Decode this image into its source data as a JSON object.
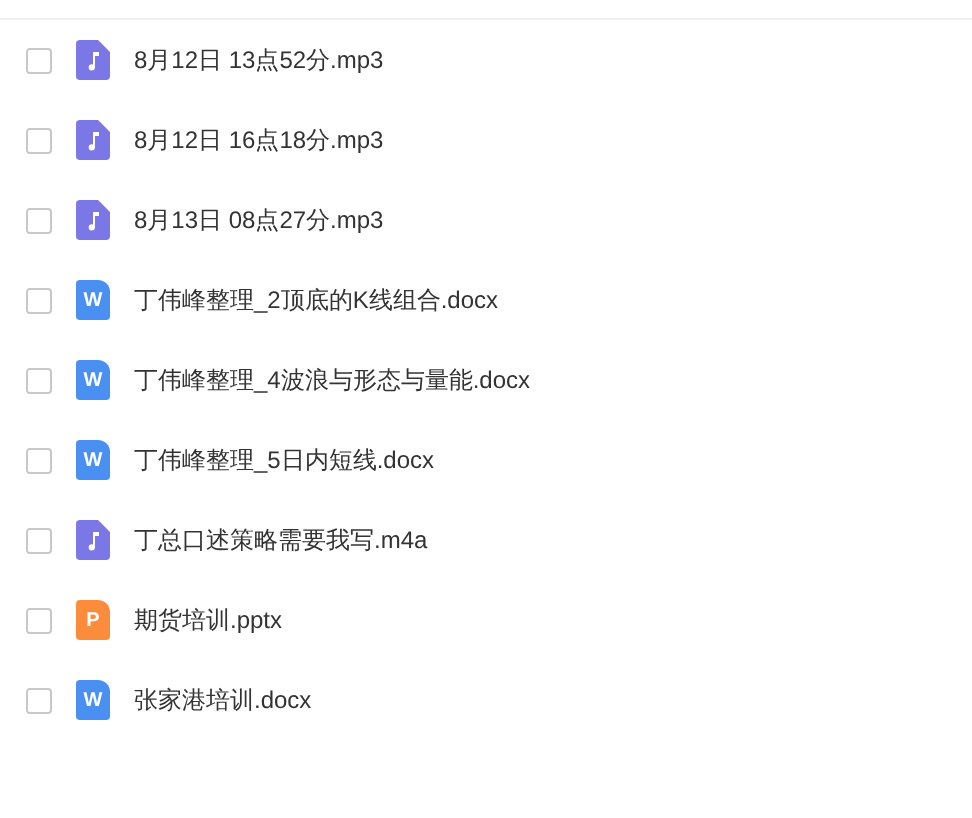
{
  "files": [
    {
      "kind": "audio",
      "name": "8月12日 13点52分.mp3",
      "checked": false
    },
    {
      "kind": "audio",
      "name": "8月12日 16点18分.mp3",
      "checked": false
    },
    {
      "kind": "audio",
      "name": "8月13日 08点27分.mp3",
      "checked": false
    },
    {
      "kind": "word",
      "badge": "W",
      "name": "丁伟峰整理_2顶底的K线组合.docx",
      "checked": false
    },
    {
      "kind": "word",
      "badge": "W",
      "name": "丁伟峰整理_4波浪与形态与量能.docx",
      "checked": false
    },
    {
      "kind": "word",
      "badge": "W",
      "name": "丁伟峰整理_5日内短线.docx",
      "checked": false
    },
    {
      "kind": "audio",
      "name": "丁总口述策略需要我写.m4a",
      "checked": false
    },
    {
      "kind": "slides",
      "badge": "P",
      "name": "期货培训.pptx",
      "checked": false
    },
    {
      "kind": "word",
      "badge": "W",
      "name": "张家港培训.docx",
      "checked": false
    }
  ]
}
